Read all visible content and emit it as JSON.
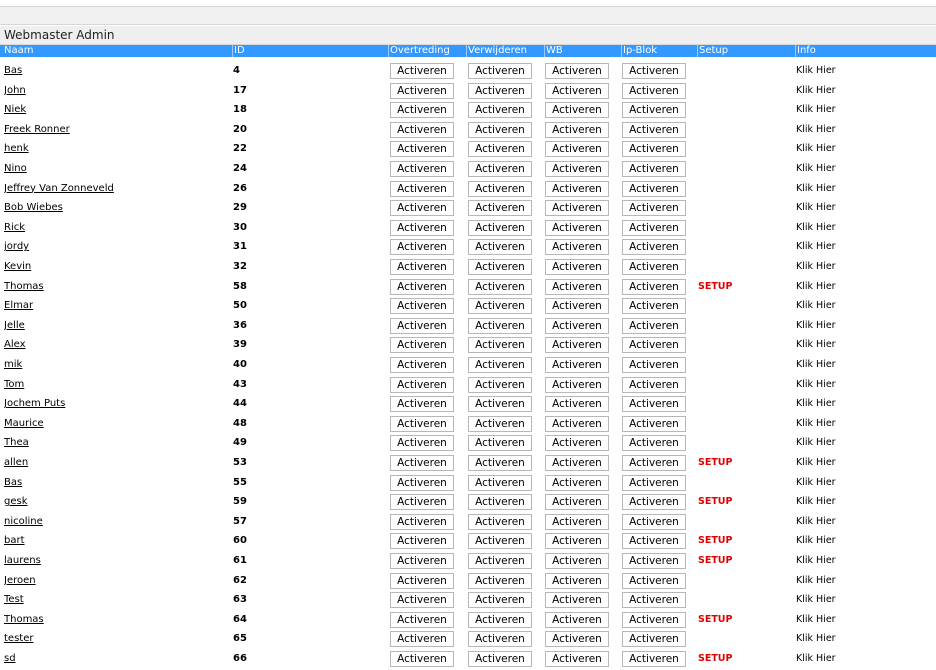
{
  "page": {
    "title": "Webmaster Admin"
  },
  "columns": {
    "naam": "Naam",
    "id": "ID",
    "overtreding": "Overtreding",
    "verwijderen": "Verwijderen",
    "wb": "WB",
    "ipblok": "Ip-Blok",
    "setup": "Setup",
    "info": "Info"
  },
  "button_label": "Activeren",
  "info_label": "Klik Hier",
  "setup_label": "SETUP",
  "colors": {
    "header_bg": "#3399ff",
    "setup": "#e00000"
  },
  "rows": [
    {
      "name": "Bas",
      "id": "4",
      "setup": false
    },
    {
      "name": "John",
      "id": "17",
      "setup": false
    },
    {
      "name": "Niek",
      "id": "18",
      "setup": false
    },
    {
      "name": "Freek Ronner",
      "id": "20",
      "setup": false
    },
    {
      "name": "henk",
      "id": "22",
      "setup": false
    },
    {
      "name": "Nino",
      "id": "24",
      "setup": false
    },
    {
      "name": "Jeffrey Van Zonneveld",
      "id": "26",
      "setup": false
    },
    {
      "name": "Bob Wiebes",
      "id": "29",
      "setup": false
    },
    {
      "name": "Rick",
      "id": "30",
      "setup": false
    },
    {
      "name": "jordy",
      "id": "31",
      "setup": false
    },
    {
      "name": "Kevin",
      "id": "32",
      "setup": false
    },
    {
      "name": "Thomas",
      "id": "58",
      "setup": true
    },
    {
      "name": "Elmar",
      "id": "50",
      "setup": false
    },
    {
      "name": "Jelle",
      "id": "36",
      "setup": false
    },
    {
      "name": "Alex",
      "id": "39",
      "setup": false
    },
    {
      "name": "mik",
      "id": "40",
      "setup": false
    },
    {
      "name": "Tom",
      "id": "43",
      "setup": false
    },
    {
      "name": "Jochem Puts",
      "id": "44",
      "setup": false
    },
    {
      "name": "Maurice",
      "id": "48",
      "setup": false
    },
    {
      "name": "Thea",
      "id": "49",
      "setup": false
    },
    {
      "name": "allen",
      "id": "53",
      "setup": true
    },
    {
      "name": "Bas",
      "id": "55",
      "setup": false
    },
    {
      "name": "gesk",
      "id": "59",
      "setup": true
    },
    {
      "name": "nicoline",
      "id": "57",
      "setup": false
    },
    {
      "name": "bart",
      "id": "60",
      "setup": true
    },
    {
      "name": "laurens",
      "id": "61",
      "setup": true
    },
    {
      "name": "Jeroen",
      "id": "62",
      "setup": false
    },
    {
      "name": "Test",
      "id": "63",
      "setup": false
    },
    {
      "name": "Thomas",
      "id": "64",
      "setup": true
    },
    {
      "name": "tester",
      "id": "65",
      "setup": false
    },
    {
      "name": "sd",
      "id": "66",
      "setup": true
    }
  ]
}
